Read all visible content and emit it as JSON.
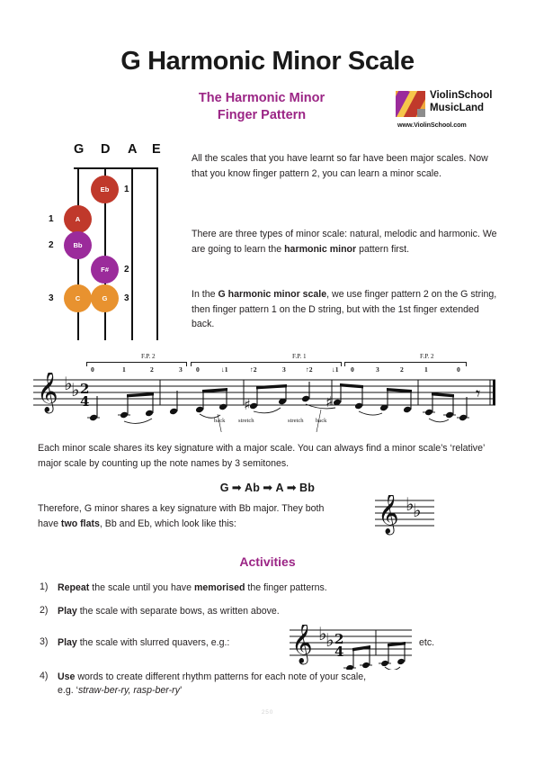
{
  "document": {
    "title": "G Harmonic Minor Scale",
    "subtitle_line1": "The Harmonic Minor",
    "subtitle_line2": "Finger Pattern",
    "page_number": "250",
    "accent_color": "#9b2585",
    "title_color": "#1a1a1a"
  },
  "logo": {
    "name_line1": "ViolinSchool",
    "name_line2": "MusicLand",
    "url": "www.ViolinSchool.com",
    "icon": "violinschool-logo-icon"
  },
  "fingerboard": {
    "string_labels": [
      "G",
      "D",
      "A",
      "E"
    ],
    "colors": {
      "red": "#c0392b",
      "purple": "#9b2b9b",
      "orange": "#e8922f"
    },
    "notes": [
      {
        "label": "Eb",
        "string": "D",
        "color": "red",
        "finger": "1",
        "finger_side": "right"
      },
      {
        "label": "A",
        "string": "G",
        "color": "red",
        "finger": "1",
        "finger_side": "left"
      },
      {
        "label": "Bb",
        "string": "G",
        "color": "purple",
        "finger": "2",
        "finger_side": "left"
      },
      {
        "label": "F#",
        "string": "D",
        "color": "purple",
        "finger": "2",
        "finger_side": "right"
      },
      {
        "label": "C",
        "string": "G",
        "color": "orange",
        "finger": "3",
        "finger_side": "left"
      },
      {
        "label": "G",
        "string": "D",
        "color": "orange",
        "finger": "3",
        "finger_side": "right"
      }
    ]
  },
  "body": {
    "intro_1": "All the scales that you have learnt so far have been major scales. Now that you know finger pattern 2, you can learn a minor scale.",
    "three_types_a": "There are three types of minor scale: natural, melodic and harmonic. We are going to learn the ",
    "three_types_b": "harmonic minor",
    "three_types_c": " pattern first.",
    "in_the_a": "In the ",
    "in_the_b": "G harmonic minor scale",
    "in_the_c": ", we use finger pattern 2 on the G string, then finger pattern 1 on the D string, but with the 1st finger extended back.",
    "each_minor": "Each minor scale shares its key signature with a major scale. You can always find a minor scale’s ‘relative’ major scale by counting up the note names by 3 semitones.",
    "therefore_a": "Therefore, G minor shares a key signature with Bb major. They both have ",
    "therefore_b": "two flats",
    "therefore_c": ", Bb and Eb, which look like this:"
  },
  "relative_major": {
    "n1": "G",
    "n2": "Ab",
    "n3": "A",
    "n4": "Bb",
    "arrow": "➡"
  },
  "activities": {
    "heading": "Activities",
    "items": [
      {
        "num": "1)",
        "bold1": "Repeat",
        "text1": " the scale until you have ",
        "bold2": "memorised",
        "text2": " the finger patterns."
      },
      {
        "num": "2)",
        "bold1": "Play",
        "text1": " the scale with separate bows, as written above.",
        "bold2": "",
        "text2": ""
      },
      {
        "num": "3)",
        "bold1": "Play",
        "text1": " the scale with slurred quavers, e.g.:",
        "bold2": "",
        "text2": "",
        "trailing": "etc."
      },
      {
        "num": "4)",
        "bold1": "Use",
        "text1": " words to create different rhythm patterns for each note of your scale,",
        "bold2": "",
        "text2": "",
        "line2_plain": "e.g. ‘",
        "line2_italic": "straw-ber-ry, rasp-ber-ry",
        "line2_end": "’"
      }
    ]
  },
  "notation": {
    "clef": "treble-clef",
    "key_signature": "two-flats",
    "key_signature_notes": [
      "Bb",
      "Eb"
    ],
    "time_signature": "2/4",
    "finger_pattern_groups": [
      {
        "label": "F.P. 2",
        "fingers": [
          "0",
          "1",
          "2",
          "3"
        ]
      },
      {
        "label": "F.P. 1",
        "fingers": [
          "0",
          "↓1",
          "↑2",
          "3",
          "↑2",
          "↓1"
        ]
      },
      {
        "label": "F.P. 2",
        "fingers": [
          "0",
          "3",
          "2",
          "1",
          "0"
        ]
      }
    ],
    "technique_words": [
      "back",
      "stretch",
      "stretch",
      "back"
    ],
    "final_rest": "quarter-rest",
    "ending": "final-barline"
  },
  "small_staff_key": {
    "clef": "treble-clef",
    "key_signature": "two-flats"
  },
  "slur_staff": {
    "clef": "treble-clef",
    "key_signature": "two-flats",
    "time_signature": "2/4",
    "description": "slurred-quavers-example"
  }
}
